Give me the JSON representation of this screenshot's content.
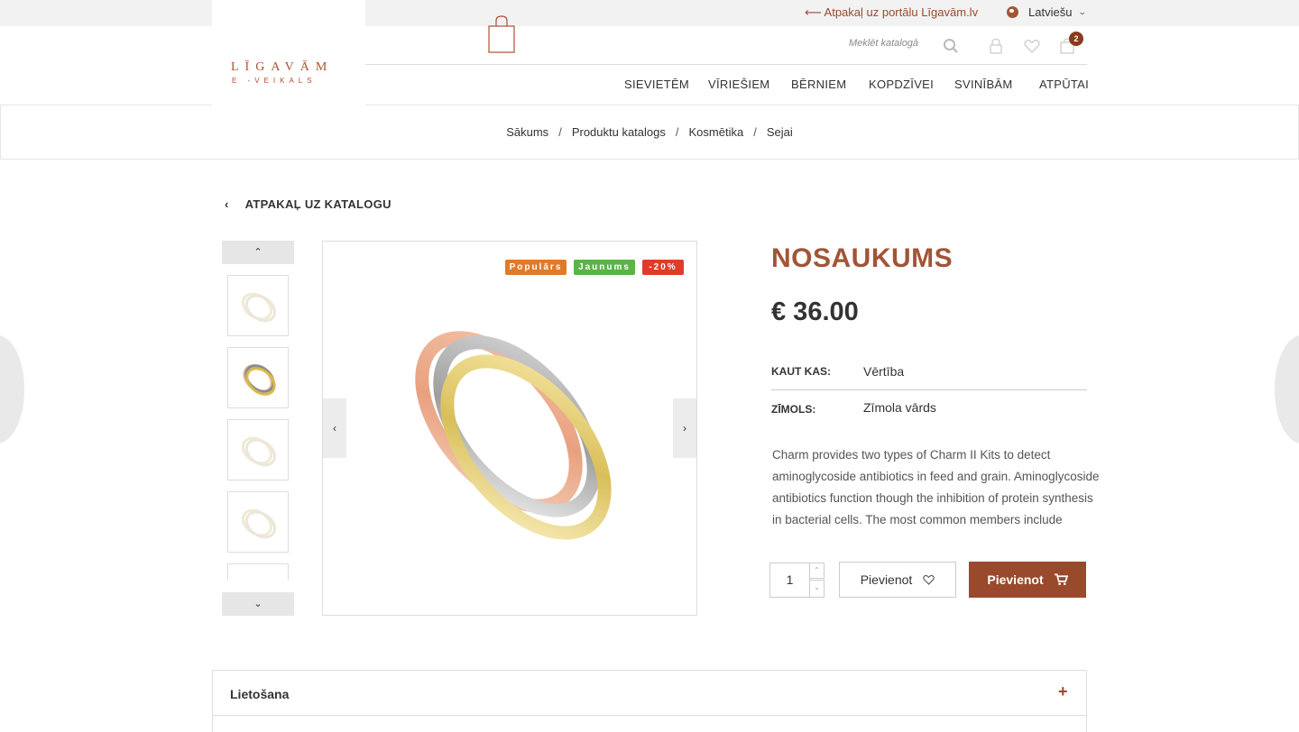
{
  "topbar": {
    "back_portal": "⟵ Atpakaļ uz portālu Līgavām.lv",
    "language": "Latviešu"
  },
  "header": {
    "logo_text": "LĪGAVĀM",
    "logo_sub": "E -VEIKALS",
    "search_placeholder": "Meklēt katalogā",
    "cart_count": "2",
    "nav": [
      "SIEVIETĒM",
      "VĪRIEŠIEM",
      "BĒRNIEM",
      "KOPDZĪVEI",
      "SVINĪBĀM",
      "ATPŪTAI"
    ]
  },
  "breadcrumb": [
    "Sākums",
    "Produktu katalogs",
    "Kosmētika",
    "Sejai"
  ],
  "back_catalog": "ATPAKAĻ UZ KATALOGU",
  "badges": [
    {
      "label": "Populārs",
      "color": "#e07b2a"
    },
    {
      "label": "Jaunums",
      "color": "#5cb348"
    },
    {
      "label": "-20%",
      "color": "#e03b2a"
    }
  ],
  "product": {
    "title": "NOSAUKUMS",
    "price": "€ 36.00",
    "attributes": [
      {
        "label": "KAUT KAS:",
        "value": "Vērtība"
      },
      {
        "label": "ZĪMOLS:",
        "value": "Zīmola vārds"
      }
    ],
    "description": "Charm provides two types of Charm II Kits to detect aminoglycoside antibiotics in feed and grain. Aminoglycoside antibiotics function though the inhibition of protein synthesis in bacterial cells. The most common members include",
    "quantity": "1",
    "wishlist_label": "Pievienot",
    "cart_label": "Pievienot"
  },
  "accordion": {
    "label": "Lietošana"
  },
  "colors": {
    "accent": "#9a4a2c",
    "title": "#a15536"
  }
}
